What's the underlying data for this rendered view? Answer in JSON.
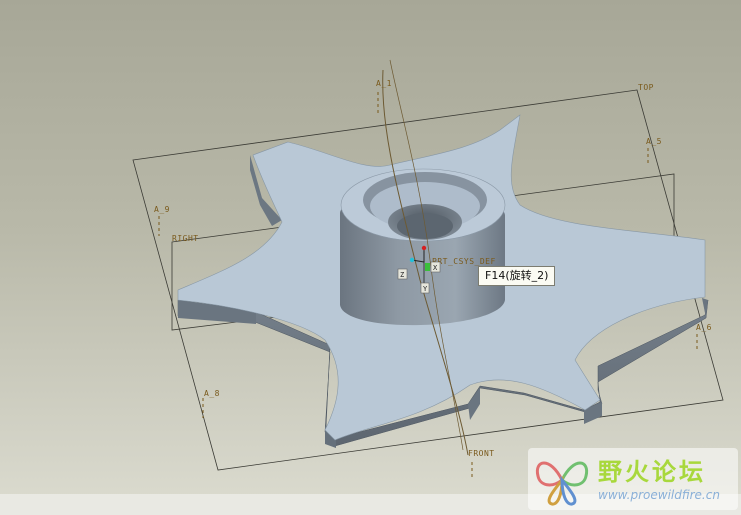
{
  "datum_planes": {
    "top": "TOP",
    "right": "RIGHT",
    "front": "FRONT"
  },
  "axes": [
    "A_1",
    "A_5",
    "A_6",
    "A_8",
    "A_9"
  ],
  "coord_sys": "PRT_CSYS_DEF",
  "axis_marks": {
    "x": "X",
    "y": "Y",
    "z": "Z"
  },
  "tooltip": "F14(旋转_2)",
  "watermark": {
    "title": "野火论坛",
    "url": "www.proewildfire.cn"
  },
  "colors": {
    "model": "#b9c8d6",
    "datum": "#7a5a1c",
    "background": "#b9b9a9"
  }
}
